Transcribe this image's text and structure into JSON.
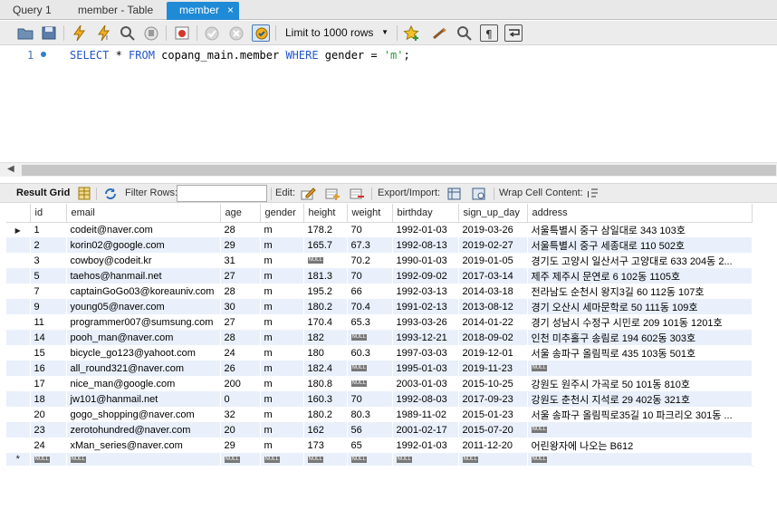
{
  "tabs": [
    {
      "label": "Query 1",
      "active": false
    },
    {
      "label": "member - Table",
      "active": false
    },
    {
      "label": "member",
      "active": true,
      "close": "×"
    }
  ],
  "toolbar": {
    "limit_label": "Limit to 1000 rows",
    "icons": [
      "open-file-icon",
      "save-icon",
      "execute-icon",
      "execute-current-icon",
      "explain-icon",
      "stop-icon",
      "toggle-error-icon",
      "commit-icon",
      "rollback-icon",
      "autocommit-icon",
      "add-snippet-icon",
      "beautify-icon",
      "find-icon",
      "invisible-chars-icon",
      "wrap-icon"
    ]
  },
  "editor": {
    "line_number": "1",
    "sql": {
      "select": "SELECT",
      "star": " * ",
      "from": "FROM",
      "table": " copang_main.member ",
      "where": "WHERE",
      "cond": " gender = ",
      "value": "'m'",
      "end": ";"
    }
  },
  "result_toolbar": {
    "result_grid": "Result Grid",
    "filter_rows": "Filter Rows:",
    "filter_value": "",
    "edit": "Edit:",
    "export_import": "Export/Import:",
    "wrap_cell": "Wrap Cell Content:"
  },
  "grid": {
    "null_label": "NULL",
    "new_row_marker": "*",
    "columns": [
      "id",
      "email",
      "age",
      "gender",
      "height",
      "weight",
      "birthday",
      "sign_up_day",
      "address"
    ],
    "rows": [
      [
        "1",
        "codeit@naver.com",
        "28",
        "m",
        "178.2",
        "70",
        "1992-01-03",
        "2019-03-26",
        "서울특별시 중구 삼일대로 343 103호"
      ],
      [
        "2",
        "korin02@google.com",
        "29",
        "m",
        "165.7",
        "67.3",
        "1992-08-13",
        "2019-02-27",
        "서울특별시 중구 세종대로 110 502호"
      ],
      [
        "3",
        "cowboy@codeit.kr",
        "31",
        "m",
        null,
        "70.2",
        "1990-01-03",
        "2019-01-05",
        "경기도 고양시 일산서구 고양대로 633 204동 2..."
      ],
      [
        "5",
        "taehos@hanmail.net",
        "27",
        "m",
        "181.3",
        "70",
        "1992-09-02",
        "2017-03-14",
        "제주 제주시 문연로 6 102동 1105호"
      ],
      [
        "7",
        "captainGoGo03@koreauniv.com",
        "28",
        "m",
        "195.2",
        "66",
        "1992-03-13",
        "2014-03-18",
        "전라남도 순천시 왕지3길 60 112동 107호"
      ],
      [
        "9",
        "young05@naver.com",
        "30",
        "m",
        "180.2",
        "70.4",
        "1991-02-13",
        "2013-08-12",
        "경기 오산시 세마문학로 50 111동 109호"
      ],
      [
        "11",
        "programmer007@sumsung.com",
        "27",
        "m",
        "170.4",
        "65.3",
        "1993-03-26",
        "2014-01-22",
        "경기 성남시 수정구 시민로 209 101동 1201호"
      ],
      [
        "14",
        "pooh_man@naver.com",
        "28",
        "m",
        "182",
        null,
        "1993-12-21",
        "2018-09-02",
        "인천 미추홀구 송림로 194 602동 303호"
      ],
      [
        "15",
        "bicycle_go123@yahoot.com",
        "24",
        "m",
        "180",
        "60.3",
        "1997-03-03",
        "2019-12-01",
        "서울 송파구 올림픽로 435 103동 501호"
      ],
      [
        "16",
        "all_round321@naver.com",
        "26",
        "m",
        "182.4",
        null,
        "1995-01-03",
        "2019-11-23",
        null
      ],
      [
        "17",
        "nice_man@google.com",
        "200",
        "m",
        "180.8",
        null,
        "2003-01-03",
        "2015-10-25",
        "강원도 원주시 가곡로 50 101동 810호"
      ],
      [
        "18",
        "jw101@hanmail.net",
        "0",
        "m",
        "160.3",
        "70",
        "1992-08-03",
        "2017-09-23",
        "강원도 춘천시 지석로 29 402동 321호"
      ],
      [
        "20",
        "gogo_shopping@naver.com",
        "32",
        "m",
        "180.2",
        "80.3",
        "1989-11-02",
        "2015-01-23",
        "서울 송파구 올림픽로35길 10 파크리오 301동 ..."
      ],
      [
        "23",
        "zerotohundred@naver.com",
        "20",
        "m",
        "162",
        "56",
        "2001-02-17",
        "2015-07-20",
        null
      ],
      [
        "24",
        "xMan_series@naver.com",
        "29",
        "m",
        "173",
        "65",
        "1992-01-03",
        "2011-12-20",
        "어린왕자에 나오는 B612"
      ]
    ]
  }
}
